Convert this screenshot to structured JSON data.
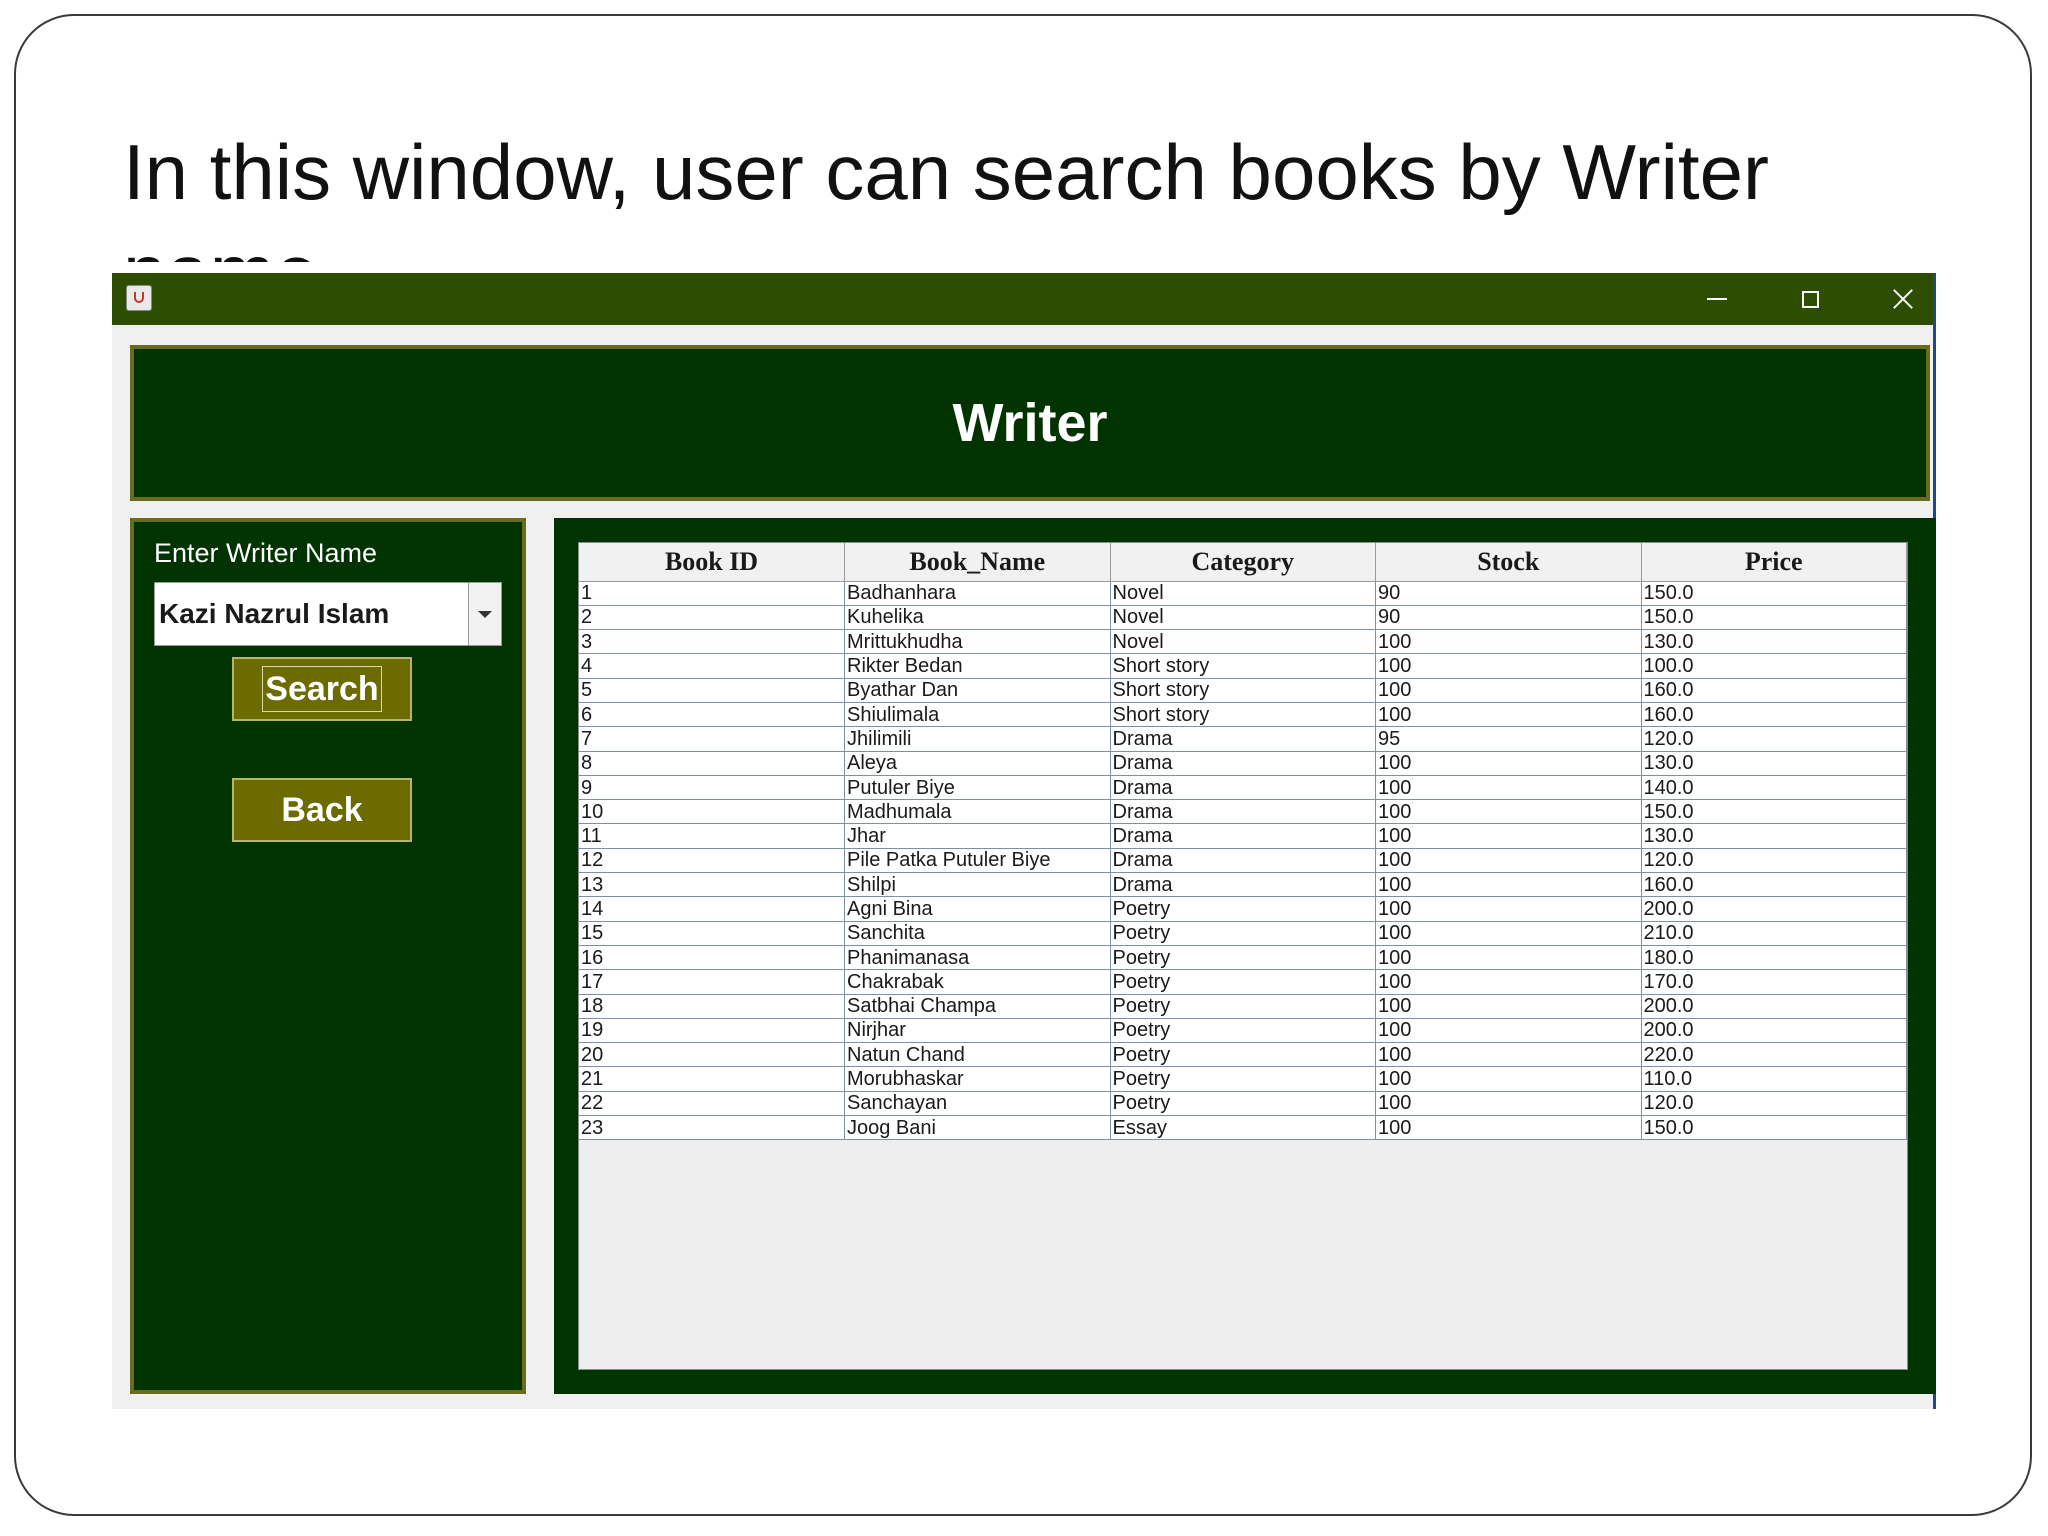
{
  "slide": {
    "title": "In this window, user can search books by Writer name"
  },
  "window": {
    "titlebar_color": "#2d4d00",
    "header_title": "Writer",
    "writer_label": "Enter Writer Name",
    "writer_select_value": "Kazi Nazrul Islam",
    "search_label": "Search",
    "back_label": "Back"
  },
  "table": {
    "columns": [
      "Book ID",
      "Book_Name",
      "Category",
      "Stock",
      "Price"
    ],
    "rows": [
      [
        "1",
        "Badhanhara",
        "Novel",
        "90",
        "150.0"
      ],
      [
        "2",
        "Kuhelika",
        "Novel",
        "90",
        "150.0"
      ],
      [
        "3",
        "Mrittukhudha",
        "Novel",
        "100",
        "130.0"
      ],
      [
        "4",
        "Rikter Bedan",
        "Short story",
        "100",
        "100.0"
      ],
      [
        "5",
        "Byathar Dan",
        "Short story",
        "100",
        "160.0"
      ],
      [
        "6",
        "Shiulimala",
        "Short story",
        "100",
        "160.0"
      ],
      [
        "7",
        "Jhilimili",
        "Drama",
        "95",
        "120.0"
      ],
      [
        "8",
        "Aleya",
        "Drama",
        "100",
        "130.0"
      ],
      [
        "9",
        "Putuler Biye",
        "Drama",
        "100",
        "140.0"
      ],
      [
        "10",
        "Madhumala",
        "Drama",
        "100",
        "150.0"
      ],
      [
        "11",
        "Jhar",
        "Drama",
        "100",
        "130.0"
      ],
      [
        "12",
        "Pile Patka Putuler Biye",
        "Drama",
        "100",
        "120.0"
      ],
      [
        "13",
        "Shilpi",
        "Drama",
        "100",
        "160.0"
      ],
      [
        "14",
        "Agni Bina",
        "Poetry",
        "100",
        "200.0"
      ],
      [
        "15",
        "Sanchita",
        "Poetry",
        "100",
        "210.0"
      ],
      [
        "16",
        "Phanimanasa",
        "Poetry",
        "100",
        "180.0"
      ],
      [
        "17",
        "Chakrabak",
        "Poetry",
        "100",
        "170.0"
      ],
      [
        "18",
        "Satbhai Champa",
        "Poetry",
        "100",
        "200.0"
      ],
      [
        "19",
        "Nirjhar",
        "Poetry",
        "100",
        "200.0"
      ],
      [
        "20",
        "Natun Chand",
        "Poetry",
        "100",
        "220.0"
      ],
      [
        "21",
        "Morubhaskar",
        "Poetry",
        "100",
        "110.0"
      ],
      [
        "22",
        "Sanchayan",
        "Poetry",
        "100",
        "120.0"
      ],
      [
        "23",
        "Joog Bani",
        "Essay",
        "100",
        "150.0"
      ]
    ]
  }
}
